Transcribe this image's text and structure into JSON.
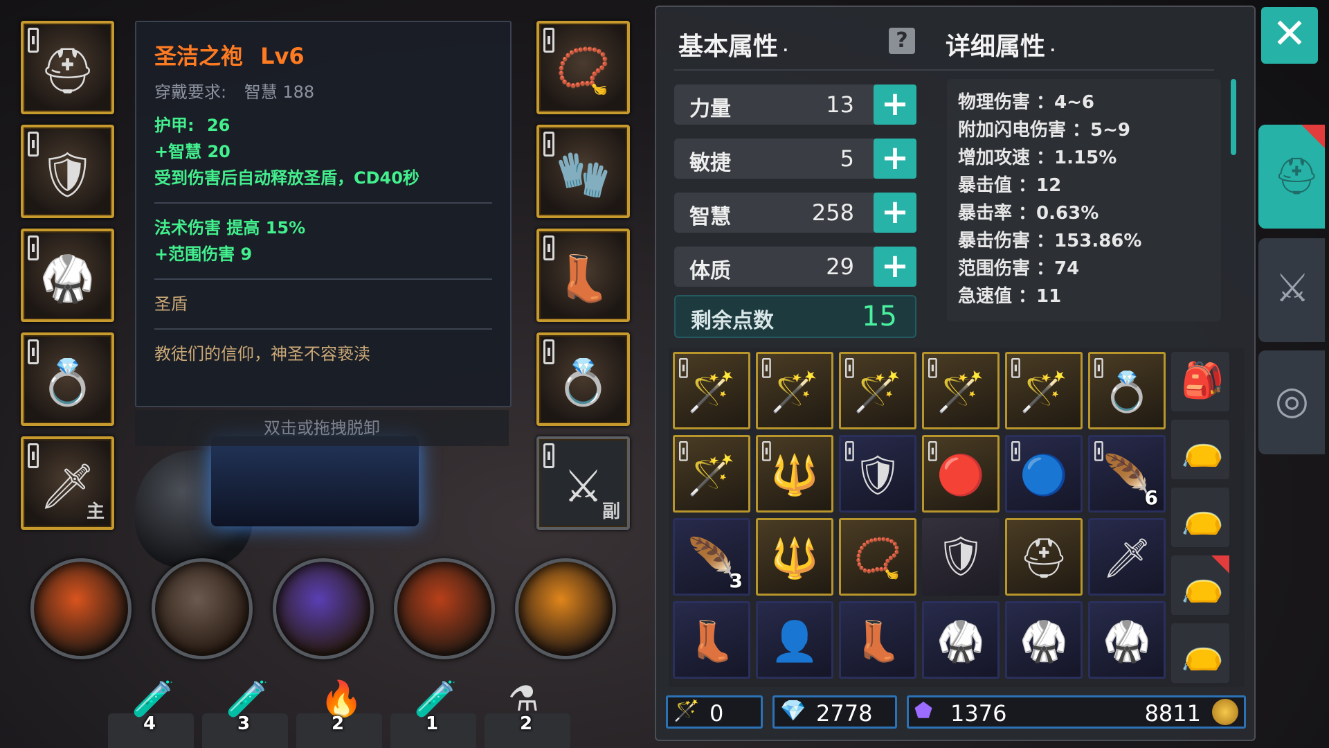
{
  "tooltip": {
    "item_name": "圣洁之袍",
    "item_level": "Lv6",
    "requirement_label": "穿戴要求:",
    "requirement_value": "智慧 188",
    "armor_label": "护甲:",
    "armor_value": "26",
    "bonus_int": "+智慧 20",
    "effect": "受到伤害后自动释放圣盾，CD40秒",
    "magic_dmg": "法术伤害 提高 15%",
    "aoe_dmg": "+范围伤害 9",
    "set_name": "圣盾",
    "flavor": "教徒们的信仰，神圣不容亵渎",
    "hint": "双击或拖拽脱卸"
  },
  "equipment_left": [
    {
      "icon": "helmet-icon",
      "glyph": "⛑"
    },
    {
      "icon": "shoulder-armor-icon",
      "glyph": "🛡"
    },
    {
      "icon": "robe-icon",
      "glyph": "🥋"
    },
    {
      "icon": "ring-icon",
      "glyph": "💍"
    },
    {
      "icon": "main-weapon-icon",
      "glyph": "🗡",
      "tag": "主"
    }
  ],
  "equipment_right": [
    {
      "icon": "amulet-icon",
      "glyph": "📿"
    },
    {
      "icon": "gloves-icon",
      "glyph": "🧤"
    },
    {
      "icon": "boots-icon",
      "glyph": "👢"
    },
    {
      "icon": "ring-icon",
      "glyph": "💍"
    },
    {
      "icon": "offhand-sword-icon",
      "glyph": "⚔",
      "tag": "副"
    }
  ],
  "skills": [
    {
      "icon": "meteor-skill-icon",
      "color": "#d9541e"
    },
    {
      "icon": "hood-skill-icon",
      "color": "#6b5a4e"
    },
    {
      "icon": "fire-ice-skill-icon",
      "color": "#5a3fb4"
    },
    {
      "icon": "fireball-skill-icon",
      "color": "#b8401a"
    },
    {
      "icon": "flame-burst-skill-icon",
      "color": "#e0861c"
    }
  ],
  "potions": [
    {
      "icon": "red-potion-icon",
      "glyph": "🧪",
      "count": "4"
    },
    {
      "icon": "red-vial-icon",
      "glyph": "🧪",
      "count": "3"
    },
    {
      "icon": "campfire-icon",
      "glyph": "🔥",
      "count": "2"
    },
    {
      "icon": "green-potion-icon",
      "glyph": "🧪",
      "count": "1"
    },
    {
      "icon": "red-flask-icon",
      "glyph": "⚗",
      "count": "2"
    }
  ],
  "panel": {
    "basic_title": "基本属性",
    "detail_title": "详细属性",
    "stats": [
      {
        "name": "力量",
        "value": "13"
      },
      {
        "name": "敏捷",
        "value": "5"
      },
      {
        "name": "智慧",
        "value": "258"
      },
      {
        "name": "体质",
        "value": "29"
      }
    ],
    "remaining_label": "剩余点数",
    "remaining_value": "15",
    "details": [
      "物理伤害 ：4~6",
      "附加闪电伤害 ：5~9",
      "增加攻速 ：1.15%",
      "暴击值 ：12",
      "暴击率 ：0.63%",
      "暴击伤害 ：153.86%",
      "范围伤害 ：74",
      "急速值 ：11"
    ]
  },
  "inventory": [
    {
      "icon": "staff-icon",
      "glyph": "🪄",
      "style": "gold",
      "count": ""
    },
    {
      "icon": "staff-icon",
      "glyph": "🪄",
      "style": "gold",
      "count": ""
    },
    {
      "icon": "staff-icon",
      "glyph": "🪄",
      "style": "gold",
      "count": ""
    },
    {
      "icon": "staff-icon",
      "glyph": "🪄",
      "style": "gold",
      "count": ""
    },
    {
      "icon": "staff-icon",
      "glyph": "🪄",
      "style": "gold",
      "count": ""
    },
    {
      "icon": "ring-icon",
      "glyph": "💍",
      "style": "gold",
      "count": ""
    },
    {
      "icon": "staff-icon",
      "glyph": "🪄",
      "style": "gold",
      "count": ""
    },
    {
      "icon": "spear-icon",
      "glyph": "🔱",
      "style": "gold",
      "count": ""
    },
    {
      "icon": "chest-armor-icon",
      "glyph": "🛡",
      "style": "blue",
      "count": ""
    },
    {
      "icon": "red-gem-icon",
      "glyph": "🔴",
      "style": "gold",
      "count": ""
    },
    {
      "icon": "blue-orb-icon",
      "glyph": "🔵",
      "style": "blue",
      "count": ""
    },
    {
      "icon": "feather-icon",
      "glyph": "🪶",
      "style": "blue",
      "count": "6"
    },
    {
      "icon": "feather-icon",
      "glyph": "🪶",
      "style": "blue",
      "count": "3"
    },
    {
      "icon": "spear-icon",
      "glyph": "🔱",
      "style": "gold",
      "count": ""
    },
    {
      "icon": "amulet-icon",
      "glyph": "📿",
      "style": "gold",
      "count": ""
    },
    {
      "icon": "chest-armor-icon",
      "glyph": "🛡",
      "style": "plain",
      "count": ""
    },
    {
      "icon": "helmet-icon",
      "glyph": "⛑",
      "style": "gold",
      "count": ""
    },
    {
      "icon": "sword-icon",
      "glyph": "🗡",
      "style": "blue",
      "count": ""
    },
    {
      "icon": "boots-icon",
      "glyph": "👢",
      "style": "blue",
      "count": ""
    },
    {
      "icon": "hood-icon",
      "glyph": "👤",
      "style": "blue",
      "count": ""
    },
    {
      "icon": "boots-icon",
      "glyph": "👢",
      "style": "blue",
      "count": ""
    },
    {
      "icon": "shoulder-armor-icon",
      "glyph": "🥋",
      "style": "blue",
      "count": ""
    },
    {
      "icon": "shoulder-armor-icon",
      "glyph": "🥋",
      "style": "blue",
      "count": ""
    },
    {
      "icon": "shoulder-armor-icon",
      "glyph": "🥋",
      "style": "blue",
      "count": ""
    }
  ],
  "bags": [
    {
      "icon": "backpack-icon",
      "glyph": "🎒"
    },
    {
      "icon": "pouch-icon",
      "glyph": "👝"
    },
    {
      "icon": "pouch-icon",
      "glyph": "👝"
    },
    {
      "icon": "pouch-icon",
      "glyph": "👝"
    },
    {
      "icon": "pouch-icon",
      "glyph": "👝"
    }
  ],
  "currency": {
    "wand_count": "0",
    "gem_count": "2778",
    "crystal_count": "1376",
    "gold_count": "8811"
  },
  "colors": {
    "accent": "#27b3a7",
    "tooltip_title": "#ff7b22",
    "stat_green": "#43f08e",
    "slot_border": "#c79a2e"
  }
}
